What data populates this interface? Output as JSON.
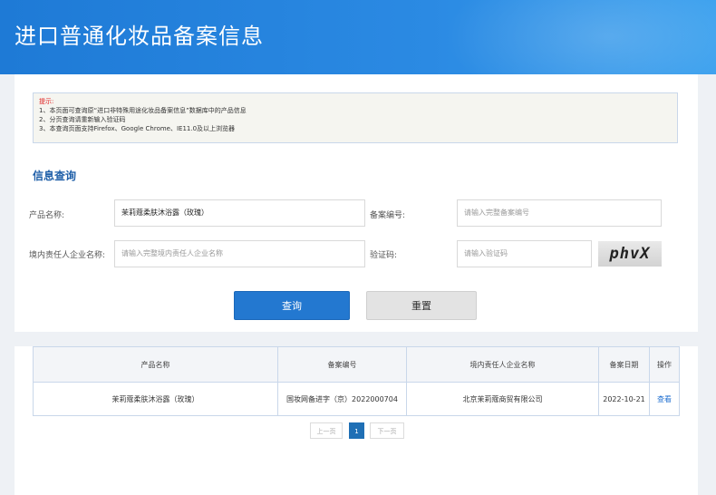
{
  "header": {
    "title": "进口普通化妆品备案信息"
  },
  "notice": {
    "title": "提示:",
    "lines": [
      "1、本页面可查询原“进口非特殊用途化妆品备案信息”数据库中的产品信息",
      "2、分页查询请重新输入验证码",
      "3、本查询页面支持Firefox、Google Chrome、IE11.0及以上浏览器"
    ]
  },
  "search": {
    "section_title": "信息查询",
    "product_name_label": "产品名称:",
    "product_name_value": "茉莉蔻柔肤沐浴露（玫瑰）",
    "record_no_label": "备案编号:",
    "record_no_placeholder": "请输入完整备案编号",
    "company_label": "境内责任人企业名称:",
    "company_placeholder": "请输入完整境内责任人企业名称",
    "captcha_label": "验证码:",
    "captcha_placeholder": "请输入验证码",
    "captcha_text": "phvX",
    "query_button": "查询",
    "reset_button": "重置"
  },
  "results": {
    "columns": [
      "产品名称",
      "备案编号",
      "境内责任人企业名称",
      "备案日期",
      "操作"
    ],
    "rows": [
      [
        "茉莉蔻柔肤沐浴露（玫瑰）",
        "国妆网备进字（京）2022000704",
        "北京茉莉蔻商贸有限公司",
        "2022-10-21",
        "查看"
      ]
    ]
  },
  "pagination": {
    "prev": "上一页",
    "current": "1",
    "next": "下一页"
  }
}
